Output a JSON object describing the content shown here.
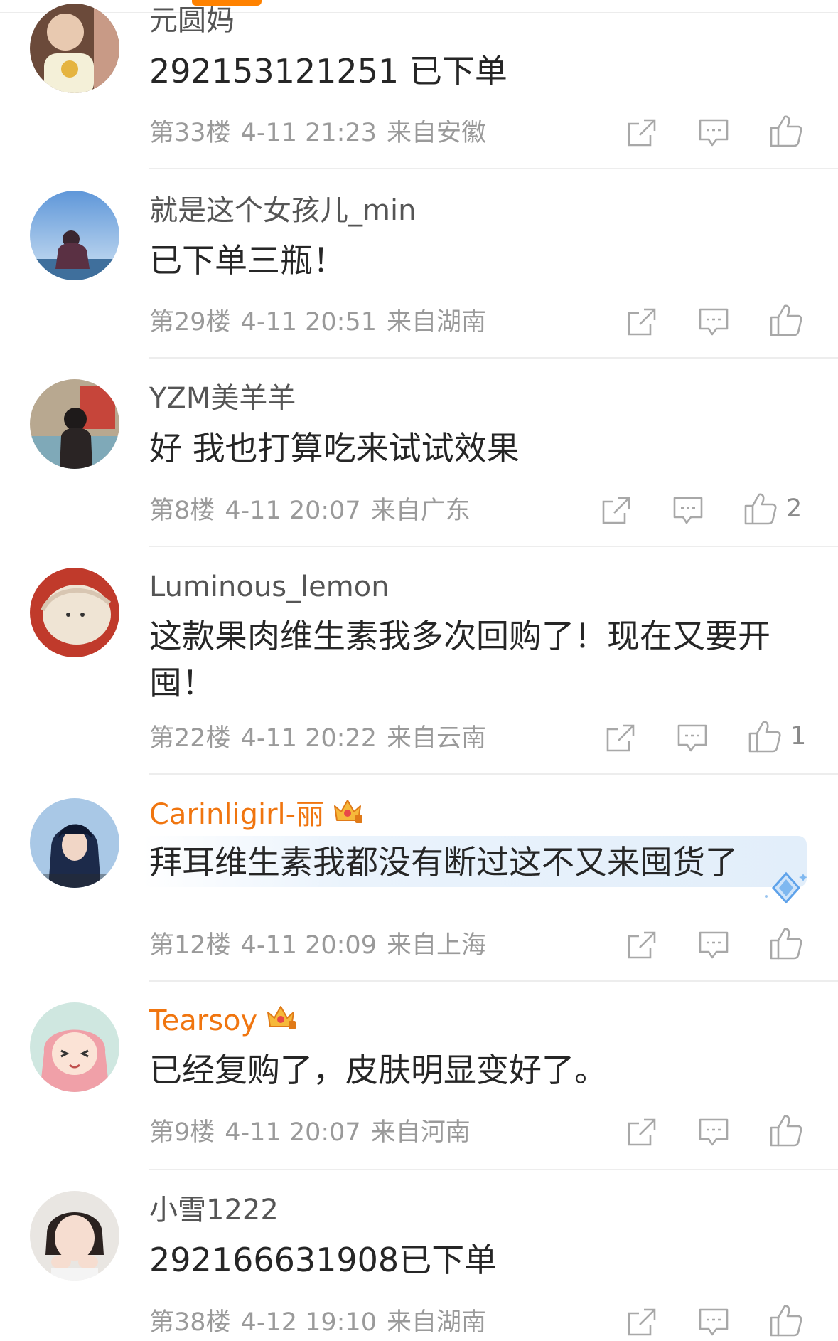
{
  "accent_color": "#ff8200",
  "vip_name_color": "#f0750f",
  "comments": [
    {
      "username": "元圆妈",
      "text": "292153121251 已下单",
      "floor": "第33楼",
      "time": "4-11 21:23",
      "location": "来自安徽",
      "likes": ""
    },
    {
      "username": "就是这个女孩儿_min",
      "text": "已下单三瓶！",
      "floor": "第29楼",
      "time": "4-11 20:51",
      "location": "来自湖南",
      "likes": ""
    },
    {
      "username": "YZM美羊羊",
      "text": "好 我也打算吃来试试效果",
      "floor": "第8楼",
      "time": "4-11 20:07",
      "location": "来自广东",
      "likes": "2"
    },
    {
      "username": "Luminous_lemon",
      "text": "这款果肉维生素我多次回购了！现在又要开囤！",
      "floor": "第22楼",
      "time": "4-11 20:22",
      "location": "来自云南",
      "likes": "1"
    },
    {
      "username": "Carinligirl-丽",
      "text": "拜耳维生素我都没有断过这不又来囤货了",
      "floor": "第12楼",
      "time": "4-11 20:09",
      "location": "来自上海",
      "likes": ""
    },
    {
      "username": "Tearsoy",
      "text": "已经复购了，皮肤明显变好了。",
      "floor": "第9楼",
      "time": "4-11 20:07",
      "location": "来自河南",
      "likes": ""
    },
    {
      "username": "小雪1222",
      "text": "292166631908已下单",
      "floor": "第38楼",
      "time": "4-12 19:10",
      "location": "来自湖南",
      "likes": ""
    }
  ],
  "icons": {
    "share": "share-icon",
    "comment": "comment-icon",
    "like": "thumbs-up-icon",
    "vip": "crown-badge-icon"
  }
}
